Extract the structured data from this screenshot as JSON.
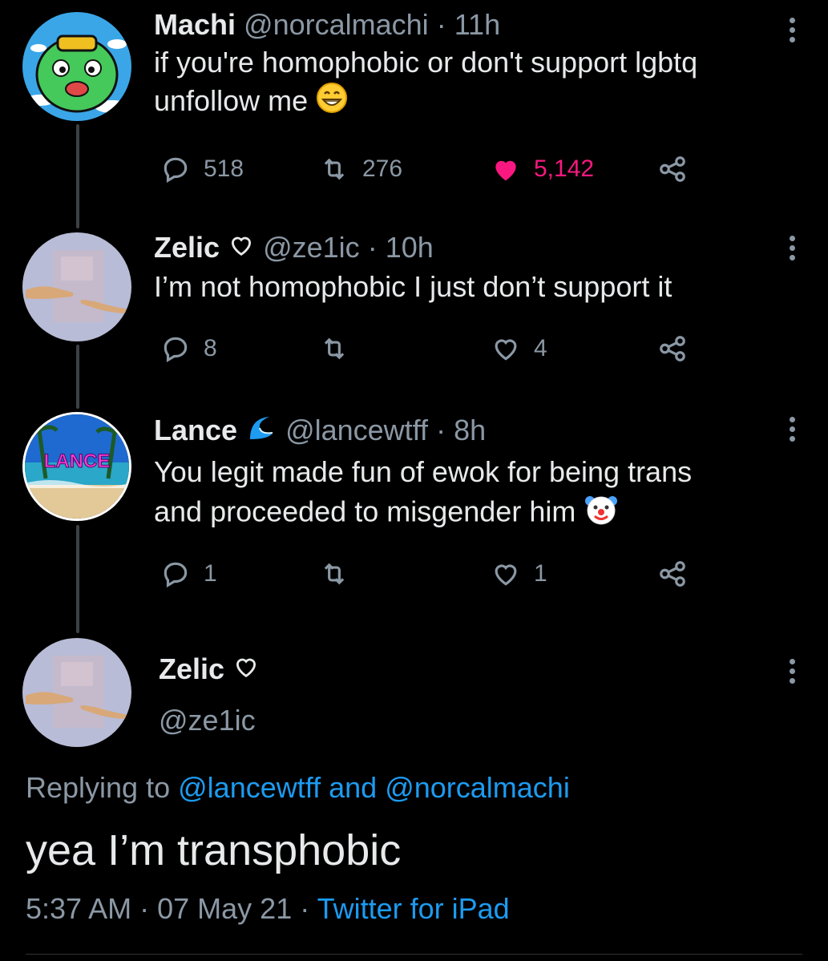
{
  "tweets": [
    {
      "name": "Machi",
      "handle": "@norcalmachi",
      "time": "11h",
      "text_line1": "if you're homophobic or don't support lgbtq",
      "text_line2": "unfollow me",
      "text_emoji": "grinning-face-emoji",
      "replies": "518",
      "retweets": "276",
      "likes": "5,142",
      "liked": true
    },
    {
      "name": "Zelic",
      "name_badge": "heart-outline-icon",
      "handle": "@ze1ic",
      "time": "10h",
      "text_line1": "I’m not homophobic I just don’t support it",
      "replies": "8",
      "retweets": "",
      "likes": "4"
    },
    {
      "name": "Lance",
      "name_badge": "wave-emoji",
      "handle": "@lancewtff",
      "time": "8h",
      "text_line1": "You legit made fun of ewok for being trans",
      "text_line2": "and proceeded to misgender him",
      "text_emoji": "clown-face-emoji",
      "replies": "1",
      "retweets": "",
      "likes": "1"
    }
  ],
  "focused": {
    "name": "Zelic",
    "name_badge": "heart-outline-icon",
    "handle": "@ze1ic",
    "replying_prefix": "Replying to",
    "replying_user1": "@lancewtff",
    "replying_and": "and",
    "replying_user2": "@norcalmachi",
    "text": "yea I’m transphobic",
    "time": "5:37 AM",
    "date": "07 May 21",
    "source": "Twitter for iPad"
  },
  "separator": "·",
  "colors": {
    "background": "#000000",
    "text": "#e7e9ea",
    "secondary": "#8b98a5",
    "link": "#1d9bf0",
    "like": "#f91880",
    "thread_line": "#3d4145"
  }
}
